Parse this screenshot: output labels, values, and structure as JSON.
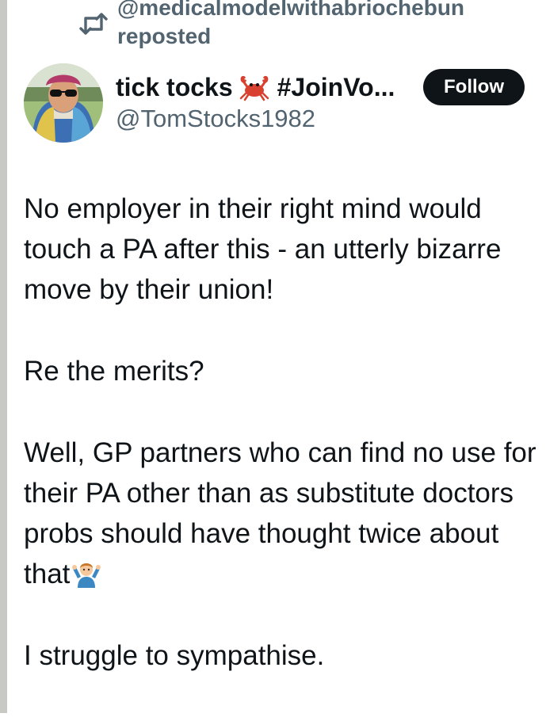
{
  "repost": {
    "icon": "repost-icon",
    "user": "@medicalmodelwithabriochebun",
    "label": "reposted"
  },
  "author": {
    "display_name": "tick tocks",
    "name_emoji": "crab-emoji",
    "hashtag_truncated": "#JoinVo...",
    "handle": "@TomStocks1982"
  },
  "follow_button": {
    "label": "Follow"
  },
  "tweet": {
    "paragraphs": [
      "No employer in their right mind would touch a PA after this - an utterly bizarre move by their union!",
      "Re the merits?",
      "Well, GP partners who can find no use for their PA other than as substitute doctors probs should have thought twice about that",
      "I struggle to sympathise."
    ],
    "trailing_emoji": "person-shrugging-emoji"
  },
  "colors": {
    "text": "#0f1419",
    "secondary": "#536471",
    "button_bg": "#0f1419",
    "button_text": "#ffffff"
  }
}
